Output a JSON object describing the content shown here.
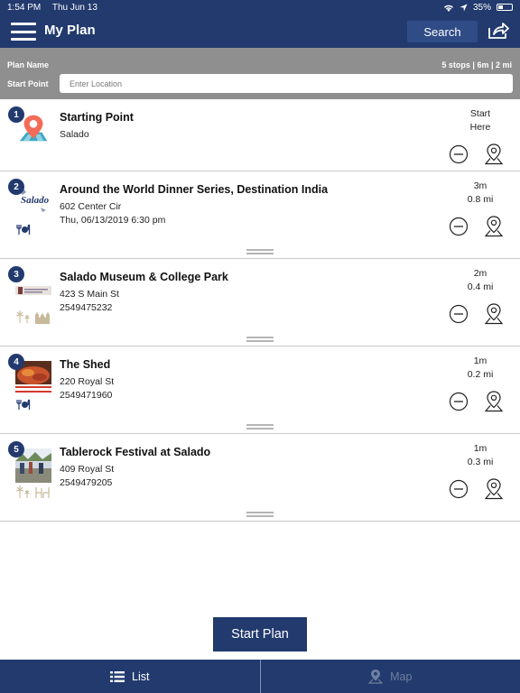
{
  "status_bar": {
    "time": "1:54 PM",
    "date": "Thu Jun 13",
    "battery": "35%",
    "battery_level": 0.35
  },
  "header": {
    "title": "My Plan",
    "search_label": "Search"
  },
  "plan": {
    "name_label": "Plan Name",
    "stats": "5 stops | 6m | 2 mi",
    "start_label": "Start Point",
    "start_placeholder": "Enter Location"
  },
  "stops": [
    {
      "num": "1",
      "title": "Starting Point",
      "line1": "Salado",
      "line2": "",
      "dist_top": "Start",
      "dist_bottom": "Here",
      "categories": []
    },
    {
      "num": "2",
      "title": "Around the World Dinner Series, Destination India",
      "line1": "602 Center Cir",
      "line2": "Thu, 06/13/2019 6:30 pm",
      "dist_top": "3m",
      "dist_bottom": "0.8 mi",
      "categories": [
        "dining-icon"
      ]
    },
    {
      "num": "3",
      "title": "Salado Museum & College Park",
      "line1": "423 S Main St",
      "line2": "2549475232",
      "dist_top": "2m",
      "dist_bottom": "0.4 mi",
      "categories": [
        "fireworks-icon",
        "museum-icon"
      ]
    },
    {
      "num": "4",
      "title": "The Shed",
      "line1": "220 Royal St",
      "line2": "2549471960",
      "dist_top": "1m",
      "dist_bottom": "0.2 mi",
      "categories": [
        "dining-icon"
      ]
    },
    {
      "num": "5",
      "title": "Tablerock Festival at Salado",
      "line1": "409 Royal St",
      "line2": "2549479205",
      "dist_top": "1m",
      "dist_bottom": "0.3 mi",
      "categories": [
        "fireworks-icon",
        "outdoor-seating-icon"
      ]
    }
  ],
  "thumb_text": {
    "salado_logo": "Salado"
  },
  "actions": {
    "start_plan_label": "Start Plan"
  },
  "tabs": {
    "list_label": "List",
    "map_label": "Map"
  },
  "colors": {
    "primary": "#223a6e",
    "plan_bar": "#8f8f8f",
    "divider": "#c8c8c8",
    "muted_tab": "#6f7f9f"
  }
}
